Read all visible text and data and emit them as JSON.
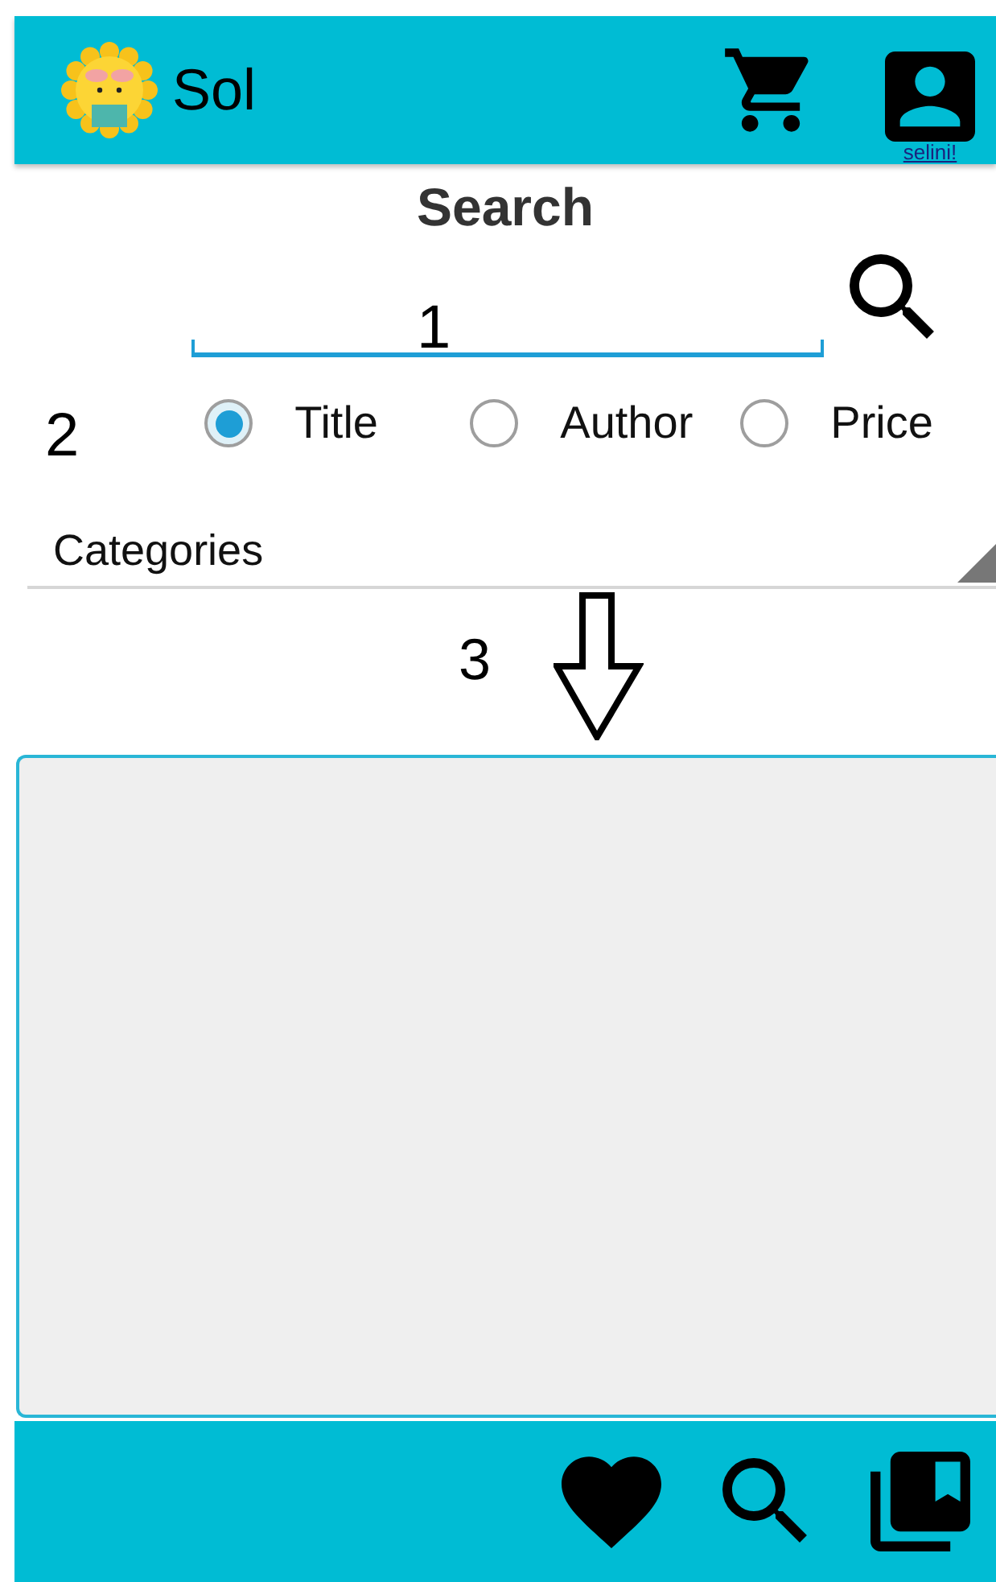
{
  "app_bar": {
    "title": "Sol",
    "username": "selini!"
  },
  "search": {
    "title": "Search"
  },
  "annotations": [
    {
      "label": "1"
    },
    {
      "label": "2"
    },
    {
      "label": "3"
    }
  ],
  "search_by": [
    {
      "label": "Title",
      "selected": true
    },
    {
      "label": "Author",
      "selected": false
    },
    {
      "label": "Price",
      "selected": false
    }
  ],
  "categories": {
    "value": "Categories"
  }
}
